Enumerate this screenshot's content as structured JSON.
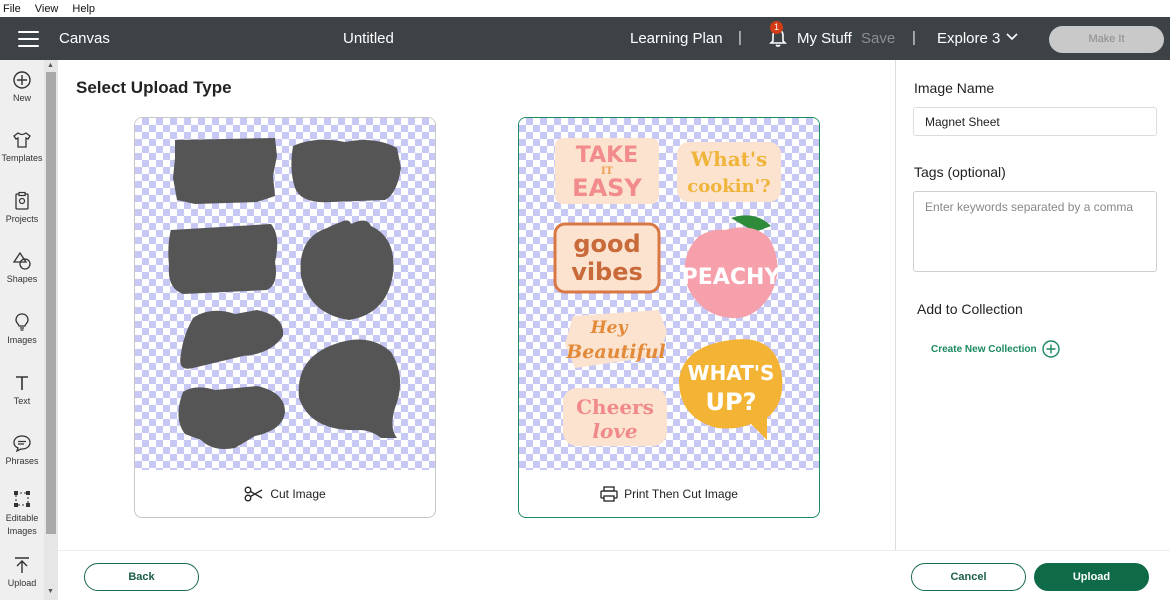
{
  "menu": [
    "File",
    "View",
    "Help"
  ],
  "header": {
    "canvas": "Canvas",
    "title": "Untitled",
    "learning": "Learning Plan",
    "separator": "|",
    "notifications": "1",
    "mystuff": "My Stuff",
    "save": "Save",
    "machine": "Explore 3",
    "makeit": "Make It"
  },
  "sidebar": {
    "items": [
      {
        "label": "New",
        "icon": "plus-circle-icon"
      },
      {
        "label": "Templates",
        "icon": "shirt-icon"
      },
      {
        "label": "Projects",
        "icon": "clipboard-icon"
      },
      {
        "label": "Shapes",
        "icon": "shapes-icon"
      },
      {
        "label": "Images",
        "icon": "bulb-icon"
      },
      {
        "label": "Text",
        "icon": "text-icon"
      },
      {
        "label": "Phrases",
        "icon": "speech-bubble-icon"
      },
      {
        "label": "Editable Images",
        "icon": "edit-path-icon"
      },
      {
        "label": "Upload",
        "icon": "upload-icon"
      }
    ]
  },
  "main": {
    "title": "Select Upload Type",
    "options": [
      {
        "label": "Cut Image",
        "icon": "scissors-icon",
        "selected": false
      },
      {
        "label": "Print Then Cut Image",
        "icon": "printer-icon",
        "selected": true
      }
    ],
    "stickers": {
      "s1": [
        "TAKE",
        "IT",
        "EASY"
      ],
      "s2": [
        "What's",
        "cookin'?"
      ],
      "s3": [
        "good",
        "vibes"
      ],
      "s4": [
        "PEACHY"
      ],
      "s5": [
        "Hey",
        "Beautiful"
      ],
      "s6": [
        "WHAT'S",
        "UP?"
      ],
      "s7": [
        "Cheers",
        "love"
      ]
    }
  },
  "panel": {
    "image_name_label": "Image Name",
    "image_name_value": "Magnet Sheet",
    "tags_label": "Tags (optional)",
    "tags_placeholder": "Enter keywords separated by a comma",
    "collection_label": "Add to Collection",
    "new_collection": "Create New Collection"
  },
  "footer": {
    "back": "Back",
    "cancel": "Cancel",
    "upload": "Upload"
  },
  "colors": {
    "topbar": "#3d4246",
    "accent": "#1b8a5f",
    "upload_button": "#0f6b47",
    "silhouette": "#555555",
    "checker": "#c8c8f5"
  }
}
